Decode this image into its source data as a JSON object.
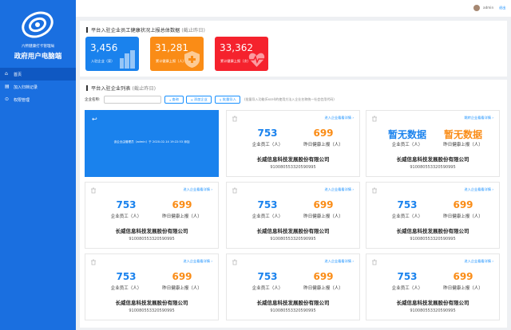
{
  "sidebar": {
    "org": "六所健康打卡管理局",
    "title": "政府用户电脑端",
    "nav": [
      {
        "label": "首页",
        "icon": "home-icon",
        "glyph": "⌂"
      },
      {
        "label": "加入归档记录",
        "icon": "document-icon",
        "glyph": "▤"
      },
      {
        "label": "权限管理",
        "icon": "lock-icon",
        "glyph": "⊙"
      }
    ]
  },
  "topbar": {
    "user": "admin",
    "logout": "退出"
  },
  "summary": {
    "title": "平台入驻企业员工健康状况上报总体数据",
    "subtitle": "(截止昨日)",
    "stats": [
      {
        "value": "3,456",
        "label": "入驻企业（家）",
        "color": "#1a82ed",
        "icon": "building-icon"
      },
      {
        "value": "31,281",
        "label": "累计健康上报（人）",
        "color": "#fa8c16",
        "icon": "medical-plus-icon"
      },
      {
        "value": "33,362",
        "label": "累计健康上报（次）",
        "color": "#f5222d",
        "icon": "heartbeat-icon"
      }
    ]
  },
  "list": {
    "title": "平台入驻企业列表",
    "subtitle": "(截止昨日)",
    "filter_label": "企业名称:",
    "search": "查询",
    "add": "添加企业",
    "import": "批量导入",
    "note": "(批量导入功能(Excel)的使用方法入企业名称统一社会信用代码)",
    "selected": {
      "log": "该企业由管理员（admin）于 2020-02-14 19:22:53 添加"
    },
    "cards": [
      {
        "detail": "进入企业看看详情 ›",
        "staff": "753",
        "staff_label": "企业员工（人）",
        "reports": "699",
        "reports_label": "昨日健康上报（人）",
        "name": "长威信息科技发展股份有限公司",
        "code": "91008055332059099​5"
      },
      {
        "detail": "跳转企业看看详情 ›",
        "staff": "暂无数据",
        "staff_label": "企业员工（人）",
        "reports": "暂无数据",
        "reports_label": "昨日健康上报（人）",
        "name": "长威信息科技发展股份有限公司",
        "code": "910080553320590995"
      },
      {
        "detail": "进入企业看看详情 ›",
        "staff": "753",
        "staff_label": "企业员工（人）",
        "reports": "699",
        "reports_label": "昨日健康上报（人）",
        "name": "长威信息科技发展股份有限公司",
        "code": "910080553320590995"
      },
      {
        "detail": "进入企业看看详情 ›",
        "staff": "753",
        "staff_label": "企业员工（人）",
        "reports": "699",
        "reports_label": "昨日健康上报（人）",
        "name": "长威信息科技发展股份有限公司",
        "code": "910080553320590995"
      },
      {
        "detail": "进入企业看看详情 ›",
        "staff": "753",
        "staff_label": "企业员工（人）",
        "reports": "699",
        "reports_label": "昨日健康上报（人）",
        "name": "长威信息科技发展股份有限公司",
        "code": "910080553320590995"
      },
      {
        "detail": "进入企业看看详情 ›",
        "staff": "753",
        "staff_label": "企业员工（人）",
        "reports": "699",
        "reports_label": "昨日健康上报（人）",
        "name": "长威信息科技发展股份有限公司",
        "code": "910080553320590995"
      },
      {
        "detail": "进入企业看看详情 ›",
        "staff": "753",
        "staff_label": "企业员工（人）",
        "reports": "699",
        "reports_label": "昨日健康上报（人）",
        "name": "长威信息科技发展股份有限公司",
        "code": "910080553320590995"
      },
      {
        "detail": "进入企业看看详情 ›",
        "staff": "753",
        "staff_label": "企业员工（人）",
        "reports": "699",
        "reports_label": "昨日健康上报（人）",
        "name": "长威信息科技发展股份有限公司",
        "code": "910080553320590995"
      }
    ]
  }
}
